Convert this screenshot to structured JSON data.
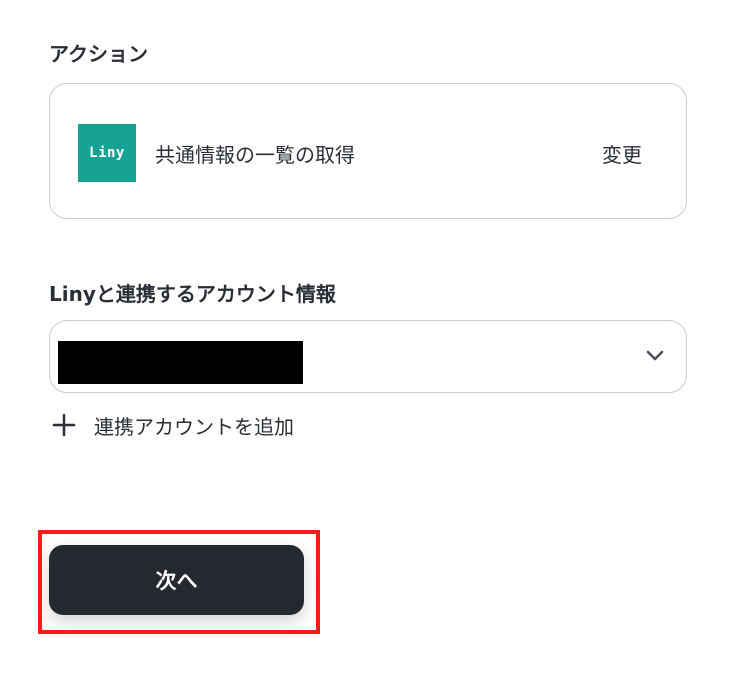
{
  "action_section": {
    "label": "アクション",
    "logo_text": "Liny",
    "action_name": "共通情報の一覧の取得",
    "change_label": "変更"
  },
  "account_section": {
    "label": "Linyと連携するアカウント情報",
    "add_account_label": "連携アカウントを追加"
  },
  "next_button_label": "次へ",
  "colors": {
    "liny_brand": "#17a394",
    "primary_button": "#25282f",
    "highlight": "#ff1a1a"
  }
}
